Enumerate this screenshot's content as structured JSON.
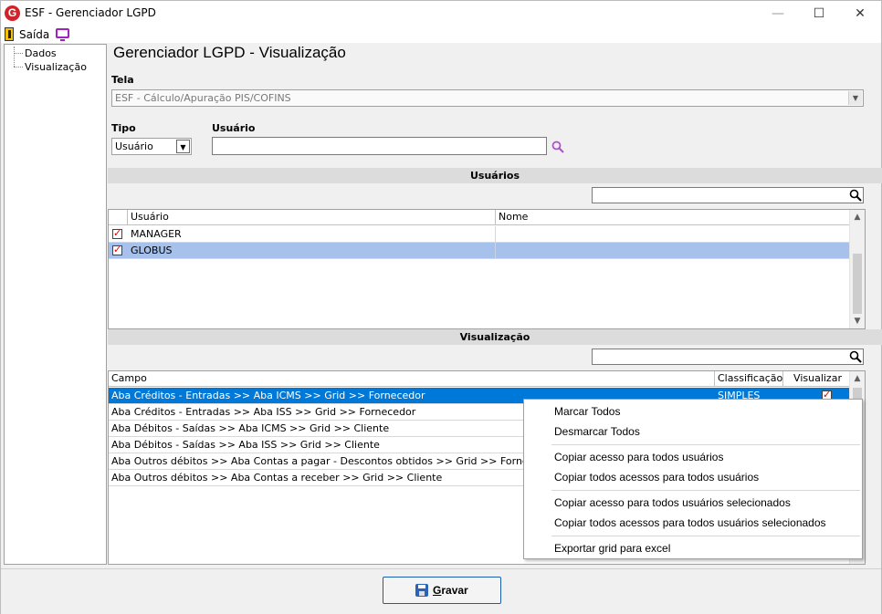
{
  "window": {
    "logo_letter": "G",
    "title": "ESF - Gerenciador LGPD",
    "minimize_glyph": "—",
    "maximize_glyph": "☐",
    "close_glyph": "✕"
  },
  "menubar": {
    "exit_label": "Saída",
    "exit_icon": "exit-door-icon",
    "monitor_icon": "monitor-icon"
  },
  "tree": {
    "items": [
      {
        "label": "Dados"
      },
      {
        "label": "Visualização"
      }
    ]
  },
  "page": {
    "title": "Gerenciador LGPD - Visualização"
  },
  "form": {
    "tela_label": "Tela",
    "tela_value": "ESF - Cálculo/Apuração PIS/COFINS",
    "tipo_label": "Tipo",
    "tipo_value": "Usuário",
    "usuario_label": "Usuário",
    "usuario_value": ""
  },
  "usuarios_section": {
    "header": "Usuários",
    "search_value": "",
    "columns": [
      "Usuário",
      "Nome"
    ],
    "rows": [
      {
        "checked": true,
        "usuario": "MANAGER",
        "nome": ""
      },
      {
        "checked": true,
        "usuario": "GLOBUS",
        "nome": ""
      }
    ]
  },
  "visualizacao_section": {
    "header": "Visualização",
    "search_value": "",
    "columns": [
      "Campo",
      "Classificação",
      "Visualizar"
    ],
    "rows": [
      {
        "campo": "Aba Créditos - Entradas >> Aba ICMS >> Grid >> Fornecedor",
        "classificacao": "SIMPLES",
        "visualizar": true
      },
      {
        "campo": "Aba Créditos - Entradas >> Aba ISS >> Grid >> Fornecedor",
        "classificacao": "",
        "visualizar": false
      },
      {
        "campo": "Aba Débitos - Saídas >> Aba ICMS >> Grid >> Cliente",
        "classificacao": "",
        "visualizar": false
      },
      {
        "campo": "Aba Débitos - Saídas >> Aba ISS >> Grid >> Cliente",
        "classificacao": "",
        "visualizar": false
      },
      {
        "campo": "Aba Outros débitos >> Aba Contas a pagar - Descontos obtidos >> Grid >> Fornecedor",
        "classificacao": "",
        "visualizar": false
      },
      {
        "campo": "Aba Outros débitos >> Aba Contas a receber >> Grid >> Cliente",
        "classificacao": "",
        "visualizar": false
      }
    ]
  },
  "context_menu": {
    "items": [
      "Marcar Todos",
      "Desmarcar Todos",
      "Copiar acesso para todos usuários",
      "Copiar todos acessos para todos usuários",
      "Copiar acesso para todos usuários selecionados",
      "Copiar todos acessos para todos usuários selecionados",
      "Exportar grid para excel"
    ]
  },
  "footer": {
    "save_label": "Gravar"
  },
  "colors": {
    "selection_blue": "#0078d7",
    "row_highlight": "#a6c1ec",
    "accent_purple": "#a020c0",
    "logo_red": "#d1232a"
  }
}
